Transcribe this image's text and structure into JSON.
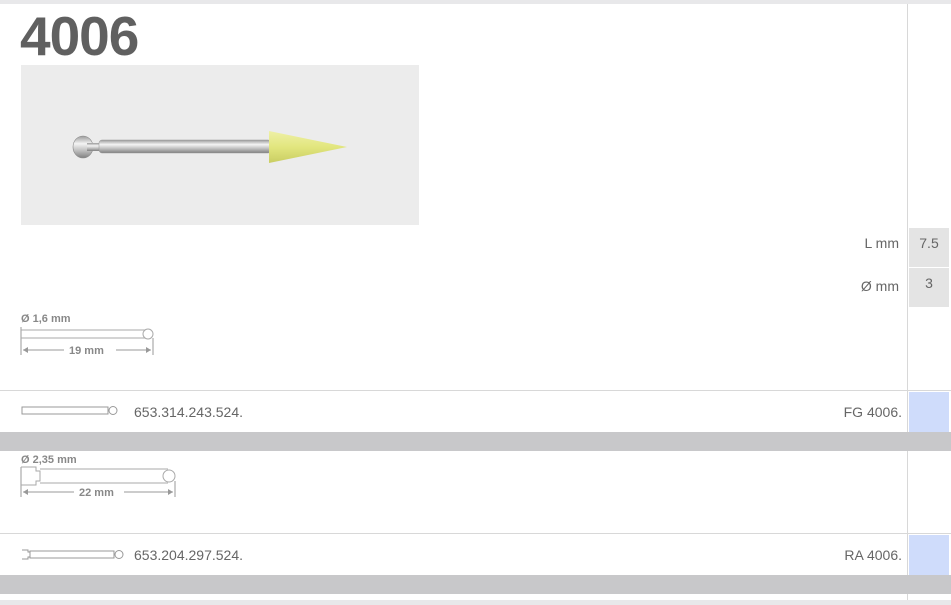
{
  "product": {
    "number": "4006",
    "image_alt": "Yellow pointed polisher on shank"
  },
  "specs": {
    "length_label": "L mm",
    "length_value": "7.5",
    "diameter_label": "Ø mm",
    "diameter_value": "3"
  },
  "shank_fg": {
    "diameter": "Ø 1,6 mm",
    "length": "19 mm",
    "code": "653.314.243.524.",
    "type": "FG 4006."
  },
  "shank_ra": {
    "diameter": "Ø 2,35 mm",
    "length": "22 mm",
    "code": "653.204.297.524.",
    "type": "RA 4006."
  },
  "colors": {
    "title": "#606060",
    "band": "#c8c8ca",
    "swatch": "#cfdcfb",
    "polisher": "#e6ea8c"
  }
}
